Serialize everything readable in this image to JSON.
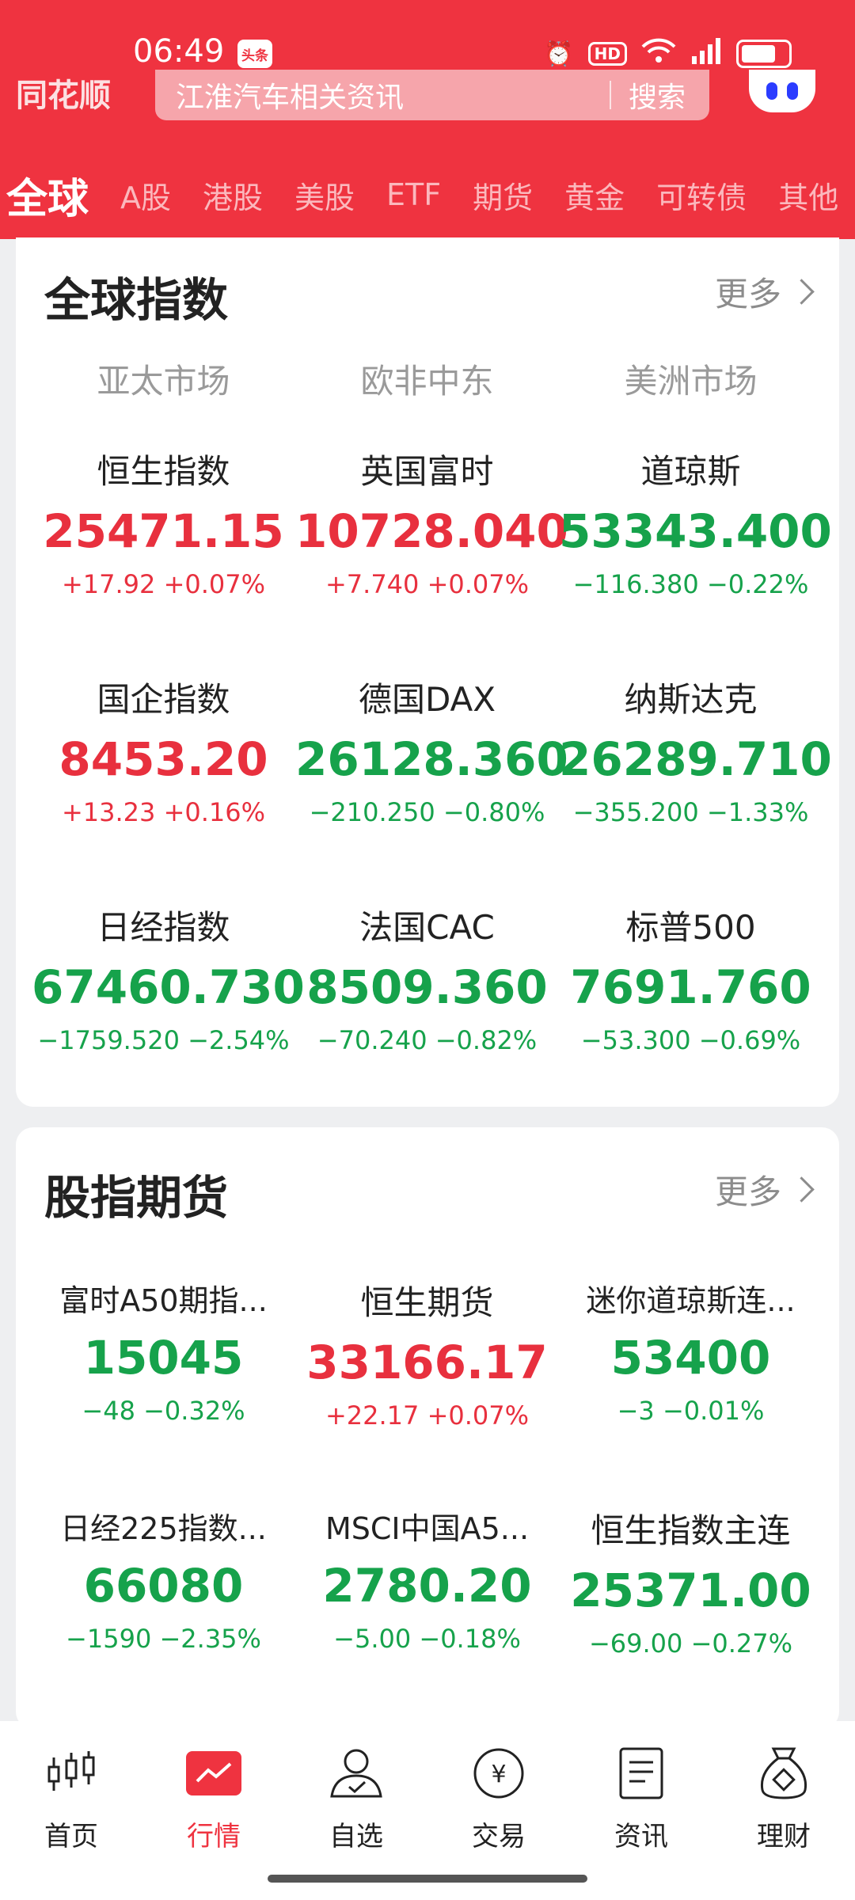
{
  "status": {
    "time": "06:49",
    "news_badge": "头条"
  },
  "header": {
    "search_placeholder": "江淮汽车相关资讯",
    "search_button": "搜索",
    "tabs": [
      "全球",
      "A股",
      "港股",
      "美股",
      "ETF",
      "期货",
      "黄金",
      "可转债",
      "其他"
    ],
    "active_tab": "全球"
  },
  "global": {
    "title": "全球指数",
    "more": "更多",
    "regions": [
      "亚太市场",
      "欧非中东",
      "美洲市场"
    ],
    "rows": [
      [
        {
          "name": "恒生指数",
          "price": "25471.15",
          "change": "+17.92 +0.07%",
          "dir": "up"
        },
        {
          "name": "英国富时",
          "price": "10728.040",
          "change": "+7.740 +0.07%",
          "dir": "up"
        },
        {
          "name": "道琼斯",
          "price": "53343.400",
          "change": "−116.380 −0.22%",
          "dir": "down"
        }
      ],
      [
        {
          "name": "国企指数",
          "price": "8453.20",
          "change": "+13.23 +0.16%",
          "dir": "up"
        },
        {
          "name": "德国DAX",
          "price": "26128.360",
          "change": "−210.250 −0.80%",
          "dir": "down"
        },
        {
          "name": "纳斯达克",
          "price": "26289.710",
          "change": "−355.200 −1.33%",
          "dir": "down"
        }
      ],
      [
        {
          "name": "日经指数",
          "price": "67460.730",
          "change": "−1759.520 −2.54%",
          "dir": "down"
        },
        {
          "name": "法国CAC",
          "price": "8509.360",
          "change": "−70.240 −0.82%",
          "dir": "down"
        },
        {
          "name": "标普500",
          "price": "7691.760",
          "change": "−53.300 −0.69%",
          "dir": "down"
        }
      ]
    ]
  },
  "futures": {
    "title": "股指期货",
    "more": "更多",
    "rows": [
      [
        {
          "name": "富时A50期指...",
          "price": "15045",
          "change": "−48 −0.32%",
          "dir": "down"
        },
        {
          "name": "恒生期货",
          "price": "33166.17",
          "change": "+22.17 +0.07%",
          "dir": "up"
        },
        {
          "name": "迷你道琼斯连...",
          "price": "53400",
          "change": "−3 −0.01%",
          "dir": "down"
        }
      ],
      [
        {
          "name": "日经225指数...",
          "price": "66080",
          "change": "−1590 −2.35%",
          "dir": "down"
        },
        {
          "name": "MSCI中国A5...",
          "price": "2780.20",
          "change": "−5.00 −0.18%",
          "dir": "down"
        },
        {
          "name": "恒生指数主连",
          "price": "25371.00",
          "change": "−69.00 −0.27%",
          "dir": "down"
        }
      ]
    ]
  },
  "nav": {
    "items": [
      "首页",
      "行情",
      "自选",
      "交易",
      "资讯",
      "理财"
    ],
    "active": "行情"
  }
}
